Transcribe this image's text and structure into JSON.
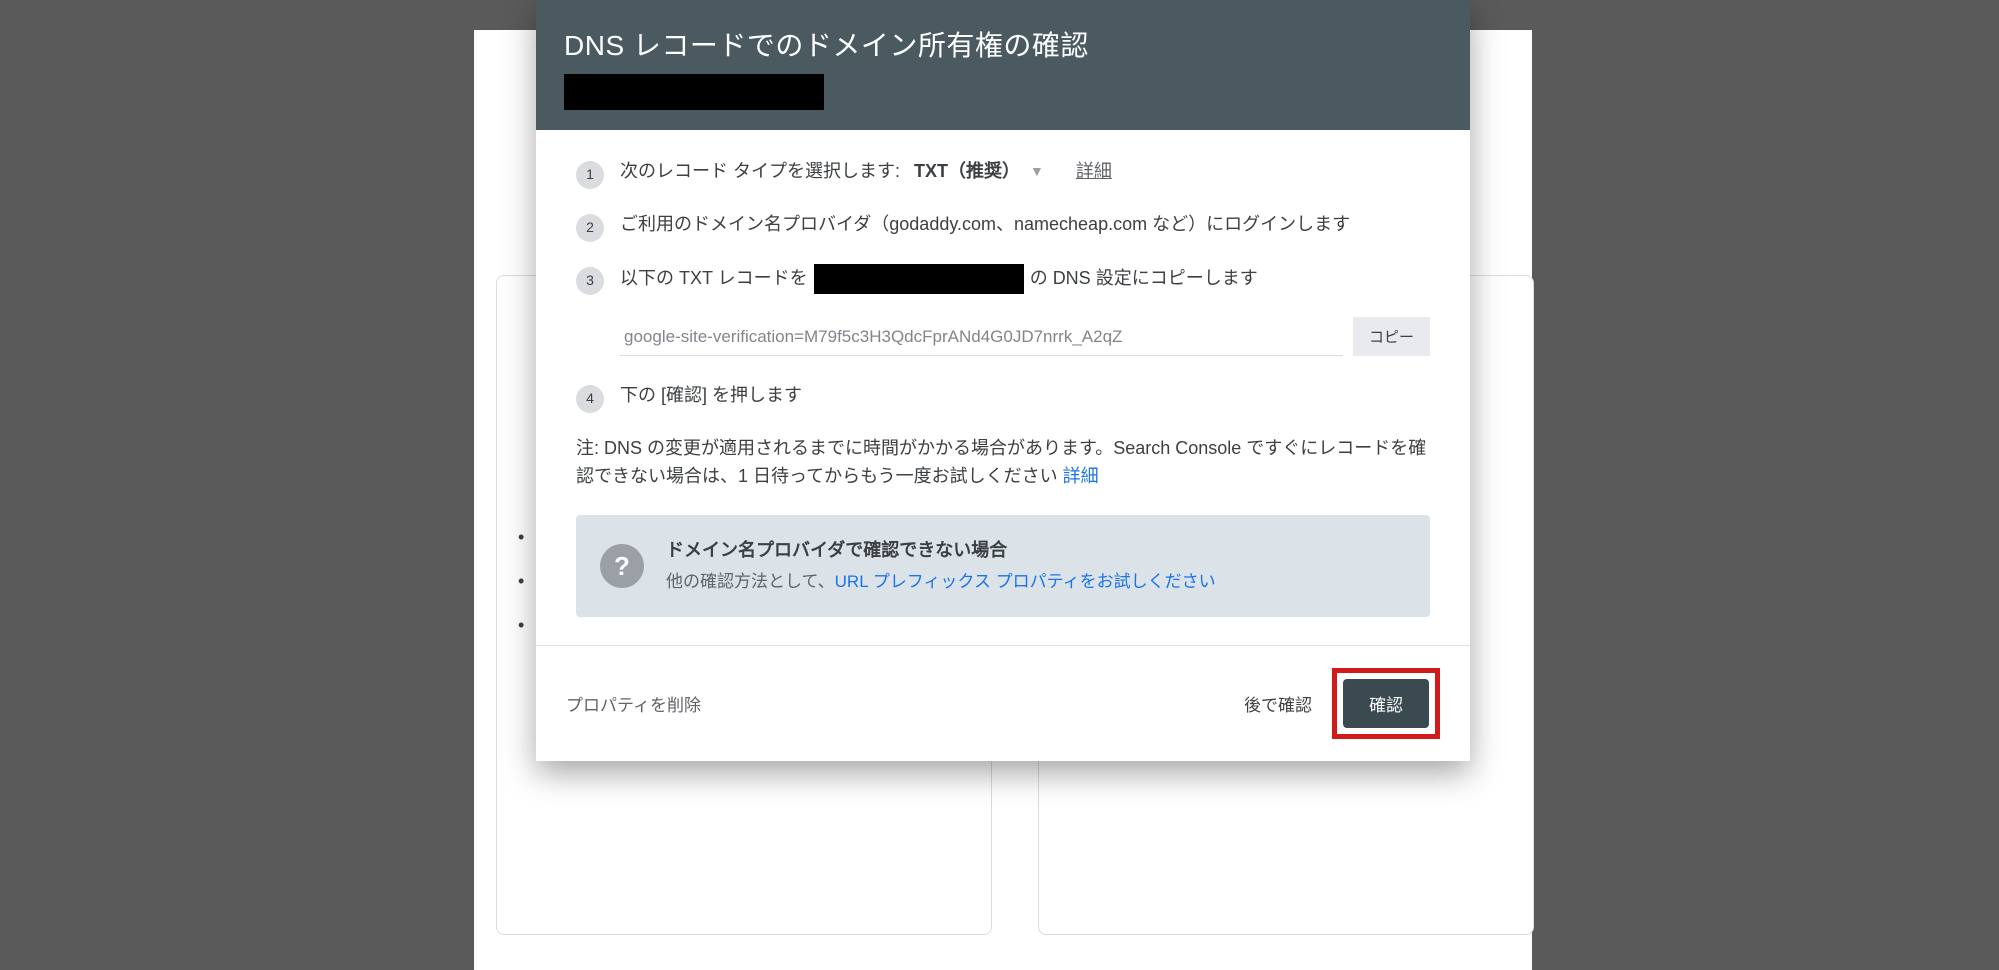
{
  "header": {
    "title": "DNS レコードでのドメイン所有権の確認"
  },
  "step1_label": "次のレコード タイプを選択します:",
  "step1_select": "TXT（推奨）",
  "step1_details": "詳細",
  "step2_text": "ご利用のドメイン名プロバイダ（godaddy.com、namecheap.com など）にログインします",
  "step3_prefix": "以下の TXT レコードを",
  "step3_suffix": "の DNS 設定にコピーします",
  "record_value": "google-site-verification=M79f5c3H3QdcFprANd4G0JD7nrrk_A2qZ",
  "copy_label": "コピー",
  "step4_text": "下の [確認] を押します",
  "note_text": "注: DNS の変更が適用されるまでに時間がかかる場合があります。Search Console ですぐにレコードを確認できない場合は、1 日待ってからもう一度お試しください ",
  "note_link": "詳細",
  "help": {
    "glyph": "?",
    "title": "ドメイン名プロバイダで確認できない場合",
    "sub_prefix": "他の確認方法として、",
    "sub_link": "URL プレフィックス プロパティをお試しください"
  },
  "footer": {
    "delete": "プロパティを削除",
    "later": "後で確認",
    "confirm": "確認"
  }
}
